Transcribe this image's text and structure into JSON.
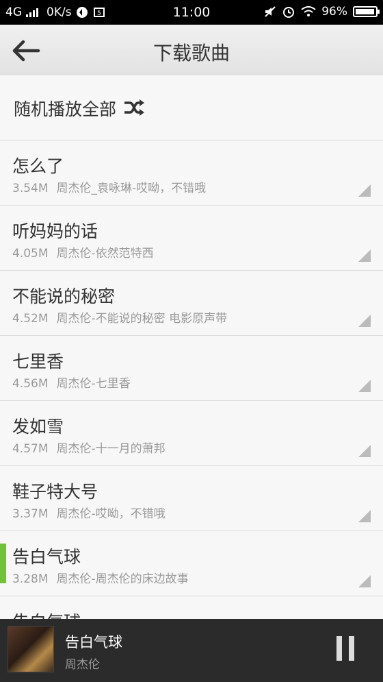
{
  "status": {
    "network": "4G",
    "speed": "0K/s",
    "time": "11:00",
    "battery": "96%"
  },
  "header": {
    "title": "下载歌曲"
  },
  "shuffle": {
    "label": "随机播放全部"
  },
  "songs": [
    {
      "name": "怎么了",
      "size": "3.54M",
      "info": "周杰伦_袁咏琳-哎呦，不错哦"
    },
    {
      "name": "听妈妈的话",
      "size": "4.05M",
      "info": "周杰伦-依然范特西"
    },
    {
      "name": "不能说的秘密",
      "size": "4.52M",
      "info": "周杰伦-不能说的秘密 电影原声带"
    },
    {
      "name": "七里香",
      "size": "4.56M",
      "info": "周杰伦-七里香"
    },
    {
      "name": "发如雪",
      "size": "4.57M",
      "info": "周杰伦-十一月的萧邦"
    },
    {
      "name": "鞋子特大号",
      "size": "3.37M",
      "info": "周杰伦-哎呦，不错哦"
    },
    {
      "name": "告白气球",
      "size": "3.28M",
      "info": "周杰伦-周杰伦的床边故事"
    },
    {
      "name": "告白气球",
      "size": "",
      "info": ""
    }
  ],
  "player": {
    "title": "告白气球",
    "artist": "周杰伦"
  },
  "colors": {
    "active": "#72c13a"
  }
}
